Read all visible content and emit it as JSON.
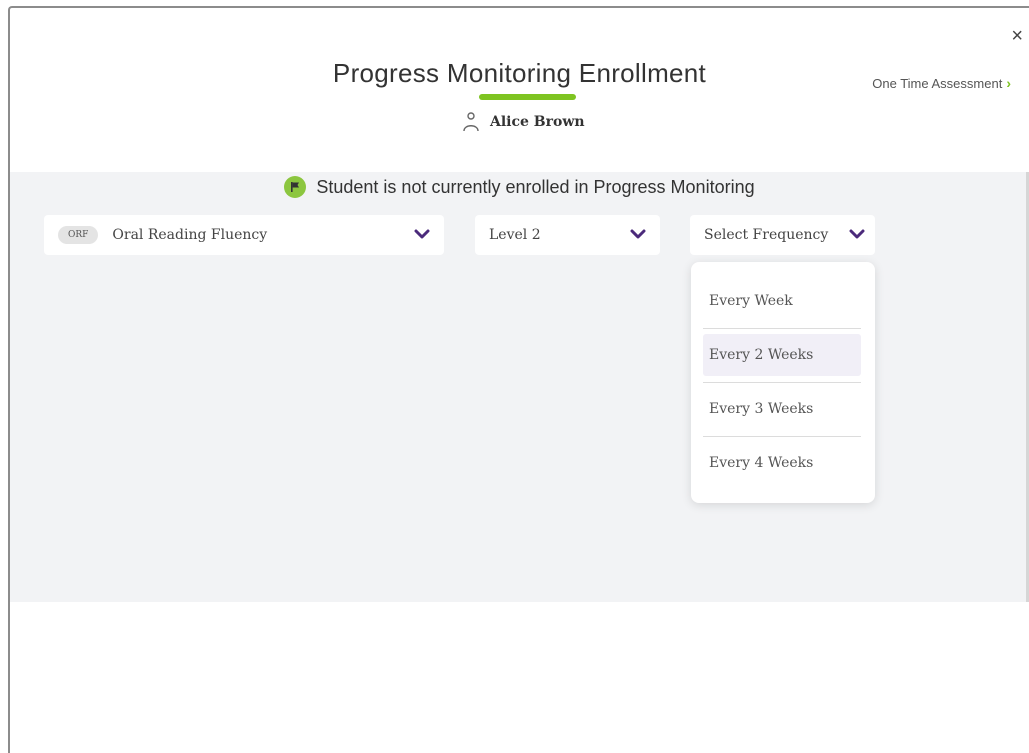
{
  "header": {
    "title": "Progress Monitoring Enrollment",
    "student_name": "Alice Brown",
    "one_time_link": "One Time Assessment",
    "close_symbol": "×"
  },
  "status": {
    "message": "Student is not currently enrolled in Progress Monitoring",
    "icon": "flag-icon"
  },
  "selects": {
    "assessment": {
      "badge": "ORF",
      "value": "Oral Reading Fluency"
    },
    "level": {
      "value": "Level 2"
    },
    "frequency": {
      "placeholder": "Select Frequency"
    }
  },
  "frequency_options": [
    "Every Week",
    "Every 2 Weeks",
    "Every 3 Weeks",
    "Every 4 Weeks"
  ],
  "highlighted_option": "Every 2 Weeks",
  "colors": {
    "accent_green": "#7ec421",
    "chevron_purple": "#4b2a7b",
    "panel_gray": "#f2f3f5"
  }
}
